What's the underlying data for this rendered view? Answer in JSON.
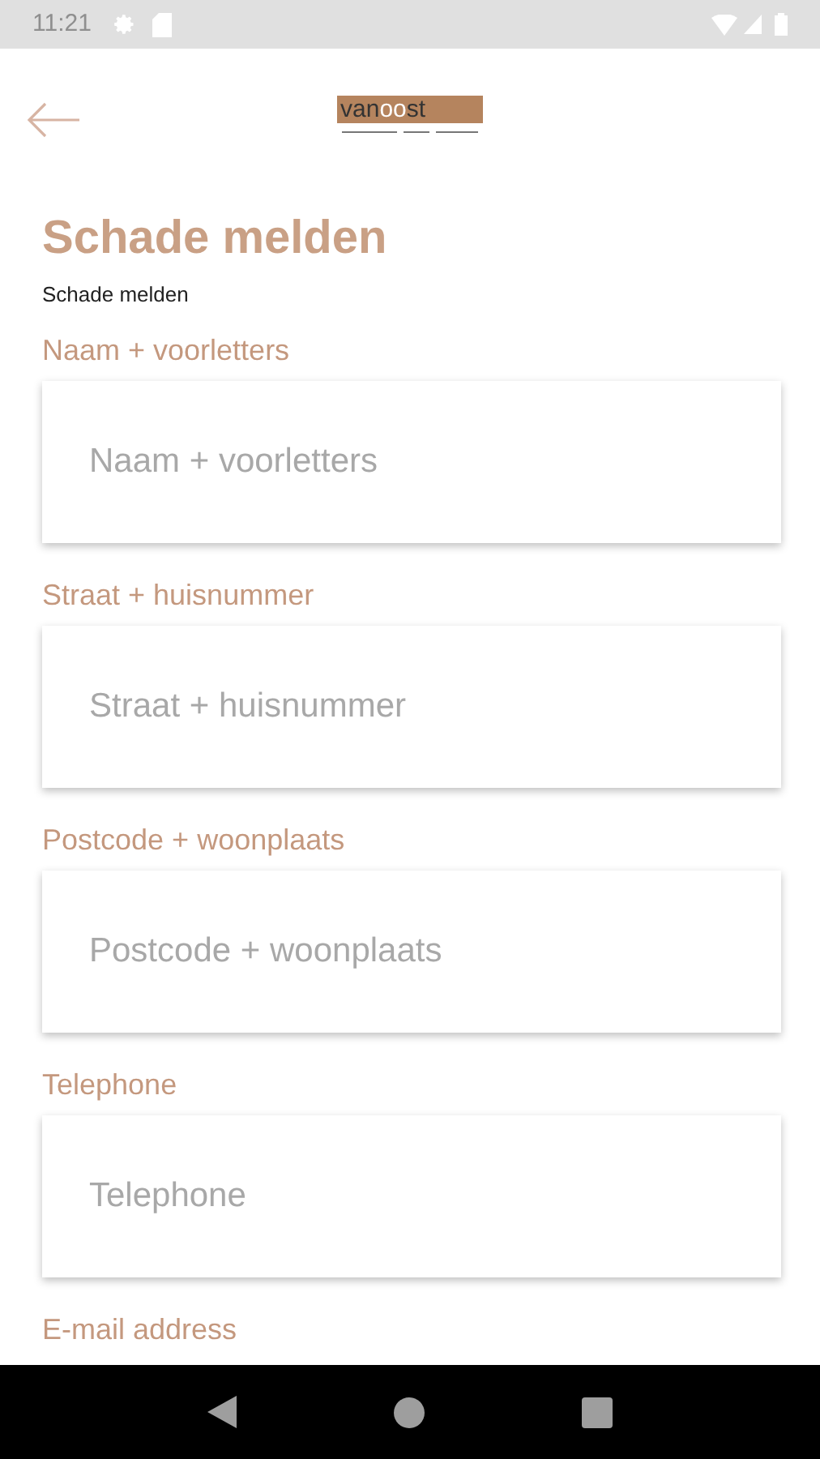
{
  "status_bar": {
    "time": "11:21"
  },
  "logo": {
    "parts": [
      {
        "text": "van",
        "highlight": false
      },
      {
        "text": "oo",
        "highlight": true
      },
      {
        "text": "st",
        "highlight": false
      }
    ]
  },
  "page": {
    "title": "Schade melden",
    "subtitle": "Schade melden"
  },
  "fields": [
    {
      "label": "Naam + voorletters",
      "placeholder": "Naam + voorletters"
    },
    {
      "label": "Straat + huisnummer",
      "placeholder": "Straat + huisnummer"
    },
    {
      "label": "Postcode + woonplaats",
      "placeholder": "Postcode + woonplaats"
    },
    {
      "label": "Telephone",
      "placeholder": "Telephone"
    }
  ],
  "next_label": "E-mail address"
}
